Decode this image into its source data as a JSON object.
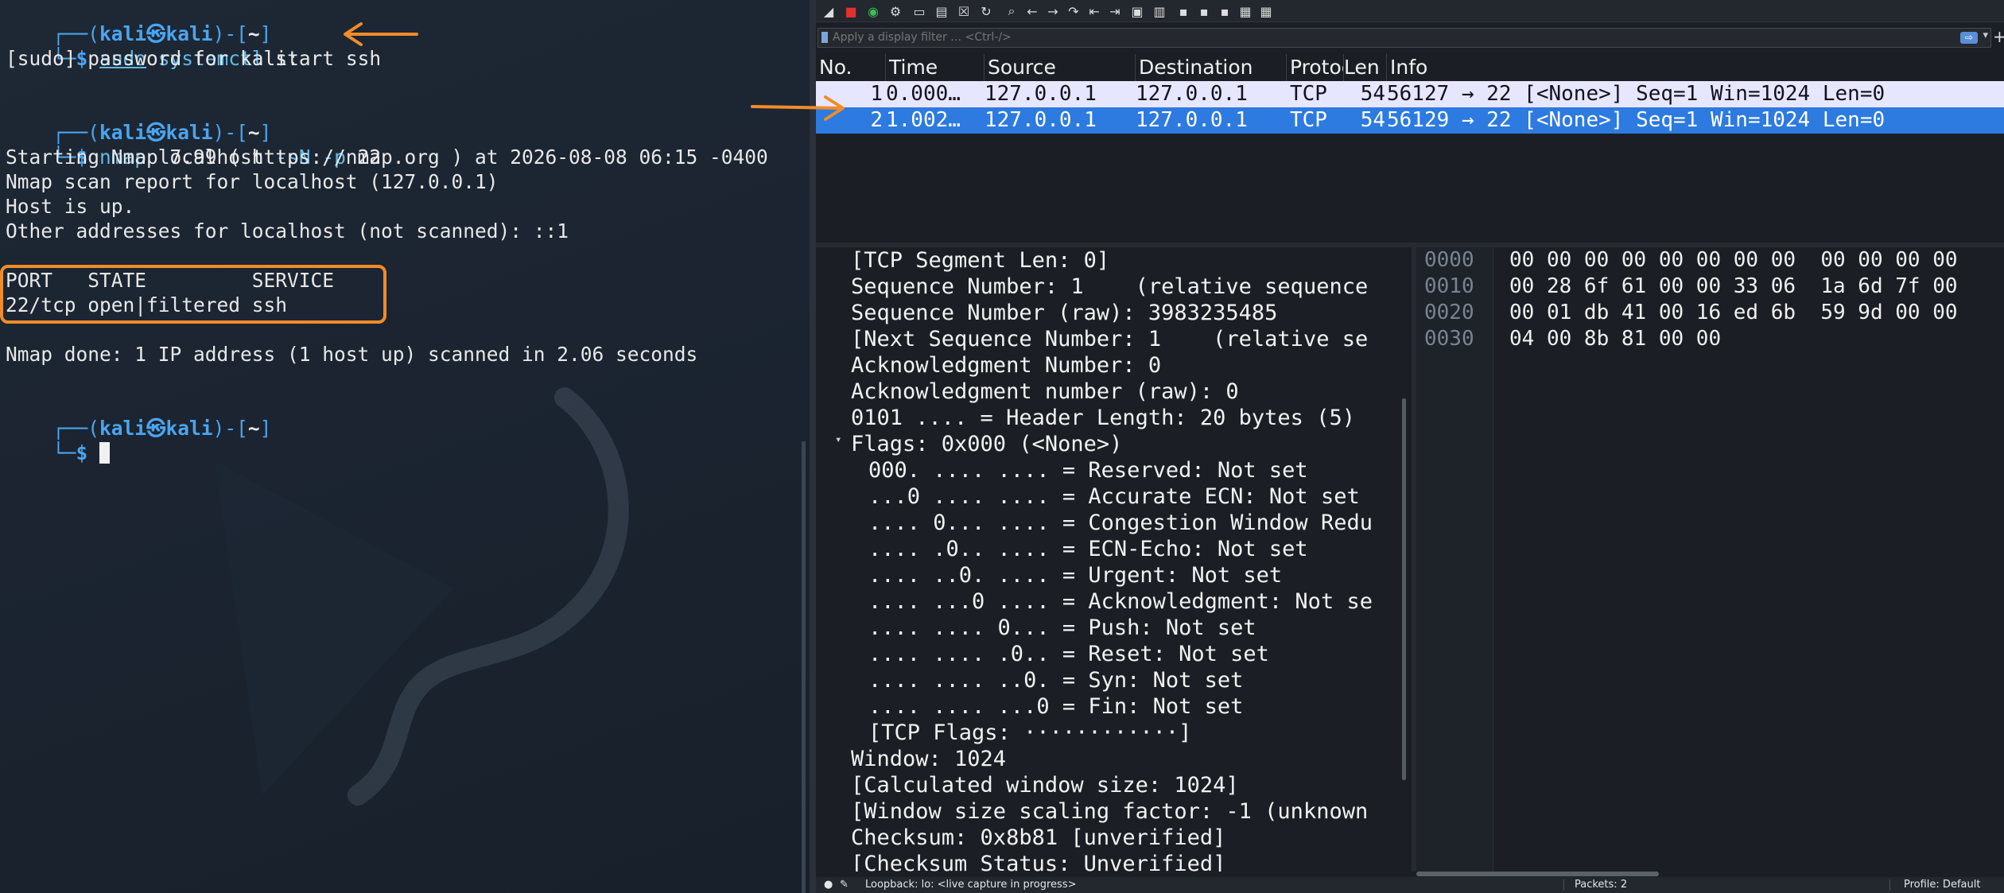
{
  "terminal": {
    "lines": [
      {
        "prefix": "┌──(",
        "user": "kali",
        "at": "㉿",
        "host": "kali",
        "mid": ")-[",
        "path": "~",
        "end": "]"
      },
      {
        "prompt": "└─$ ",
        "cmd_a": "sudo",
        "cmd_b": " systemctl",
        "cmd_c": " start ssh"
      },
      {
        "text": "[sudo] password for kali:"
      },
      {
        "prefix": "┌──(",
        "user": "kali",
        "at": "㉿",
        "host": "kali",
        "mid": ")-[",
        "path": "~",
        "end": "]"
      },
      {
        "prompt": "└─$ ",
        "cmd_a": "nmap",
        "cmd_b": " localhost",
        "cmd_c": " -sN -p",
        "cmd_d": " 22"
      },
      {
        "text": "Starting Nmap 7.99 ( https://nmap.org ) at 2026-08-08 06:15 -0400"
      },
      {
        "text": "Nmap scan report for localhost (127.0.0.1)"
      },
      {
        "text": "Host is up."
      },
      {
        "text": "Other addresses for localhost (not scanned): ::1"
      },
      {
        "text": "PORT   STATE         SERVICE"
      },
      {
        "text": "22/tcp open|filtered ssh"
      },
      {
        "text": "Nmap done: 1 IP address (1 host up) scanned in 2.06 seconds"
      },
      {
        "prefix": "┌──(",
        "user": "kali",
        "at": "㉿",
        "host": "kali",
        "mid": ")-[",
        "path": "~",
        "end": "]"
      },
      {
        "prompt": "└─$ "
      }
    ]
  },
  "wireshark": {
    "filter_placeholder": "Apply a display filter … <Ctrl-/>",
    "columns": [
      "No.",
      "Time",
      "Source",
      "Destination",
      "Protoc",
      "Len",
      "Info"
    ],
    "packets": [
      {
        "no": "1",
        "time": "0.000…",
        "source": "127.0.0.1",
        "destination": "127.0.0.1",
        "protocol": "TCP",
        "length": "54",
        "info": "56127 → 22 [<None>] Seq=1 Win=1024 Len=0"
      },
      {
        "no": "2",
        "time": "1.002…",
        "source": "127.0.0.1",
        "destination": "127.0.0.1",
        "protocol": "TCP",
        "length": "54",
        "info": "56129 → 22 [<None>] Seq=1 Win=1024 Len=0"
      }
    ],
    "details": [
      "[TCP Segment Len: 0]",
      "Sequence Number: 1    (relative sequence",
      "Sequence Number (raw): 3983235485",
      "[Next Sequence Number: 1    (relative se",
      "Acknowledgment Number: 0",
      "Acknowledgment number (raw): 0",
      "0101 .... = Header Length: 20 bytes (5)",
      "Flags: 0x000 (<None>)",
      "000. .... .... = Reserved: Not set",
      "...0 .... .... = Accurate ECN: Not set",
      ".... 0... .... = Congestion Window Redu",
      ".... .0.. .... = ECN-Echo: Not set",
      ".... ..0. .... = Urgent: Not set",
      ".... ...0 .... = Acknowledgment: Not se",
      ".... .... 0... = Push: Not set",
      ".... .... .0.. = Reset: Not set",
      ".... .... ..0. = Syn: Not set",
      ".... .... ...0 = Fin: Not set",
      "[TCP Flags: ············]",
      "Window: 1024",
      "[Calculated window size: 1024]",
      "[Window size scaling factor: -1 (unknown",
      "Checksum: 0x8b81 [unverified]",
      "[Checksum Status: Unverified]"
    ],
    "bytes": [
      {
        "offset": "0000",
        "hex": "00 00 00 00 00 00 00 00  00 00 00 00"
      },
      {
        "offset": "0010",
        "hex": "00 28 6f 61 00 00 33 06  1a 6d 7f 00"
      },
      {
        "offset": "0020",
        "hex": "00 01 db 41 00 16 ed 6b  59 9d 00 00"
      },
      {
        "offset": "0030",
        "hex": "04 00 8b 81 00 00"
      }
    ],
    "status": {
      "capture": "Loopback: lo: <live capture in progress>",
      "packets": "Packets: 2",
      "profile": "Profile: Default"
    }
  },
  "colors": {
    "accent_orange": "#f08c2a",
    "selected_row": "#2d7ae0",
    "normal_row": "#e7e6ff",
    "prompt_blue": "#4aa5f0"
  }
}
